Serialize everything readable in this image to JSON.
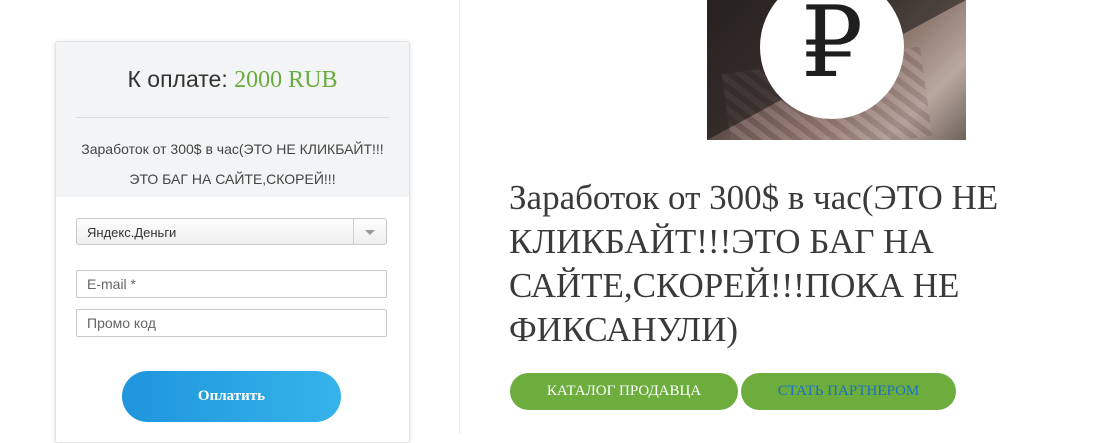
{
  "payment": {
    "total_label": "К оплате:",
    "total_amount": "2000 RUB",
    "description": "Заработок от 300$ в час(ЭТО НЕ КЛИКБАЙТ!!!ЭТО БАГ НА САЙТЕ,СКОРЕЙ!!!",
    "method_selected": "Яндекс.Деньги",
    "email_placeholder": "E-mail *",
    "promo_placeholder": "Промо код",
    "pay_button_label": "Оплатить"
  },
  "product": {
    "image_symbol": "₽",
    "title": "Заработок от 300$ в час(ЭТО НЕ КЛИКБАЙТ!!!ЭТО БАГ НА САЙТЕ,СКОРЕЙ!!!ПОКА НЕ ФИКСАНУЛИ)",
    "catalog_button_label": "КАТАЛОГ ПРОДАВЦА",
    "partner_button_label": "СТАТЬ ПАРТНЕРОМ"
  },
  "colors": {
    "accent_green": "#6cad3e",
    "pay_button_blue": "#1f95dd",
    "partner_text_blue": "#1b6fc4"
  },
  "icons": {
    "select_arrow": "chevron-down-icon",
    "product_image": "rouble-icon"
  }
}
